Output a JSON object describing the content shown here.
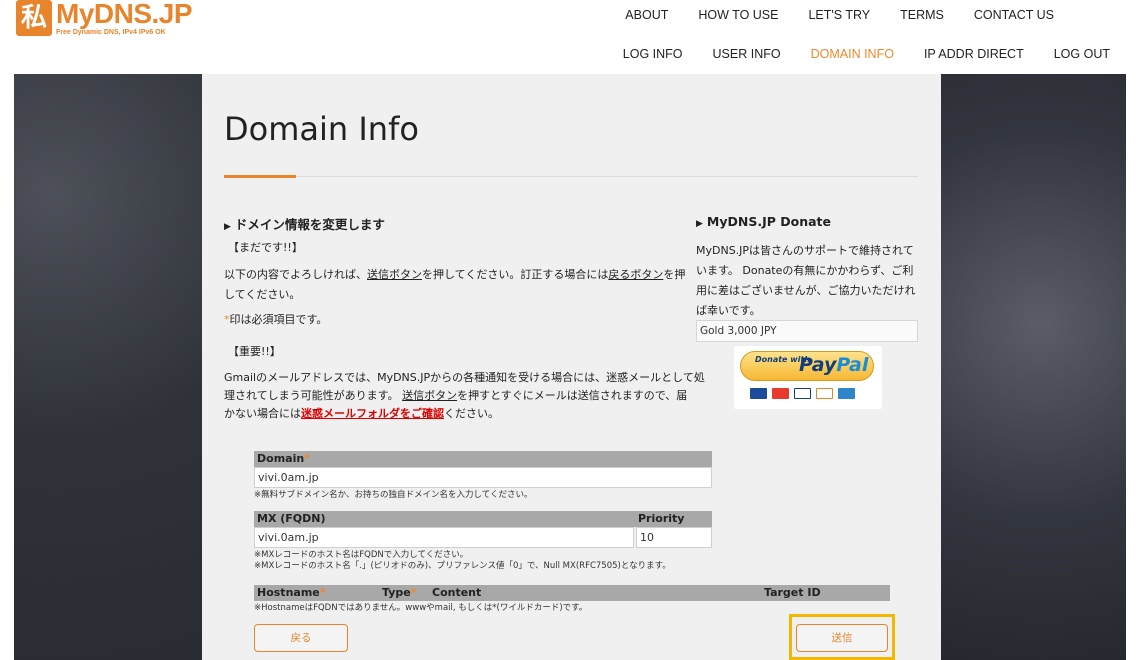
{
  "header": {
    "logo_mark": "私",
    "logo_title": "MyDNS.JP",
    "logo_subtitle": "Free Dynamic DNS, IPv4 IPv6 OK",
    "top_nav": [
      "ABOUT",
      "HOW TO USE",
      "LET'S TRY",
      "TERMS",
      "CONTACT US"
    ],
    "bottom_nav": [
      "LOG INFO",
      "USER INFO",
      "DOMAIN INFO",
      "IP ADDR DIRECT",
      "LOG OUT"
    ],
    "active_item": "DOMAIN INFO",
    "accent_color": "#f0882a"
  },
  "page": {
    "title": "Domain Info"
  },
  "left": {
    "heading": "ドメイン情報を変更します",
    "not_yet": "【まだです!!】",
    "confirm_1": "以下の内容でよろしければ、",
    "confirm_send_link": "送信ボタン",
    "confirm_2": "を押してください。訂正する場合には",
    "confirm_back_link": "戻るボタン",
    "confirm_3": "を押",
    "confirm_4": "してください。",
    "required_mark": "*",
    "required_text": "印は必須項目です。",
    "important": "【重要!!】",
    "gmail_1": "Gmailのメールアドレスでは、MyDNS.JPからの各種通知を受ける場合には、迷惑メールとして処",
    "gmail_2a": "理されてしまう可能性があります。",
    "gmail_send_link": "送信ボタン",
    "gmail_2b": "を押すとすぐにメールは送信されますので、届",
    "gmail_3a": "かない場合には",
    "gmail_spam_link": "迷惑メールフォルダをご確認",
    "gmail_3b": "ください。"
  },
  "right": {
    "heading": "MyDNS.JP Donate",
    "text_1": "MyDNS.JPは皆さんのサポートで維持されて",
    "text_2": "います。 Donateの有無にかかわらず、ご利",
    "text_3": "用に差はございませんが、ご協力いただけれ",
    "text_4": "ば幸いです。",
    "select_value": "Gold 3,000 JPY",
    "donate_small": "Donate with",
    "donate_paypal_a": "Pay",
    "donate_paypal_b": "Pal"
  },
  "form": {
    "domain_label": "Domain",
    "domain_value": "vivi.0am.jp",
    "domain_note": "※無料サブドメイン名か、お持ちの独自ドメイン名を入力してください。",
    "mx_label": "MX (FQDN)",
    "priority_label": "Priority",
    "mx_value": "vivi.0am.jp",
    "priority_value": "10",
    "mx_note_1": "※MXレコードのホスト名はFQDNで入力してください。",
    "mx_note_2": "※MXレコードのホスト名「.」(ピリオドのみ)、プリファレンス値「0」で、Null MX(RFC7505)となります。",
    "hostname_label": "Hostname",
    "type_label": "Type",
    "content_label": "Content",
    "target_label": "Target ID",
    "hostname_note": "※HostnameはFQDNではありません。wwwやmail, もしくは*(ワイルドカード)です。",
    "back_button": "戻る",
    "send_button": "送信"
  }
}
